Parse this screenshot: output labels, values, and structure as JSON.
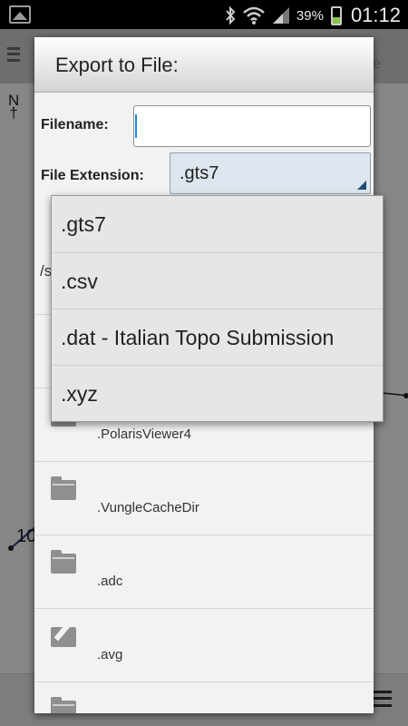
{
  "status_bar": {
    "battery_percent": "39%",
    "time": "01:12"
  },
  "background": {
    "north_label": "N",
    "map_number": "10",
    "partial_title_letter": "e"
  },
  "dialog": {
    "title": "Export to File:",
    "filename_label": "Filename:",
    "filename_value": "",
    "extension_label": "File Extension:",
    "extension_selected": ".gts7",
    "path_partial": "/s"
  },
  "dropdown_options": [
    ".gts7",
    ".csv",
    ".dat - Italian Topo Submission",
    ".xyz"
  ],
  "file_list": [
    {
      "name": ".PolarisViewer4",
      "icon": "folder-icon"
    },
    {
      "name": ".VungleCacheDir",
      "icon": "folder-icon"
    },
    {
      "name": ".adc",
      "icon": "folder-icon"
    },
    {
      "name": ".avg",
      "icon": "edit-icon"
    },
    {
      "name": "",
      "icon": "folder-icon"
    }
  ]
}
